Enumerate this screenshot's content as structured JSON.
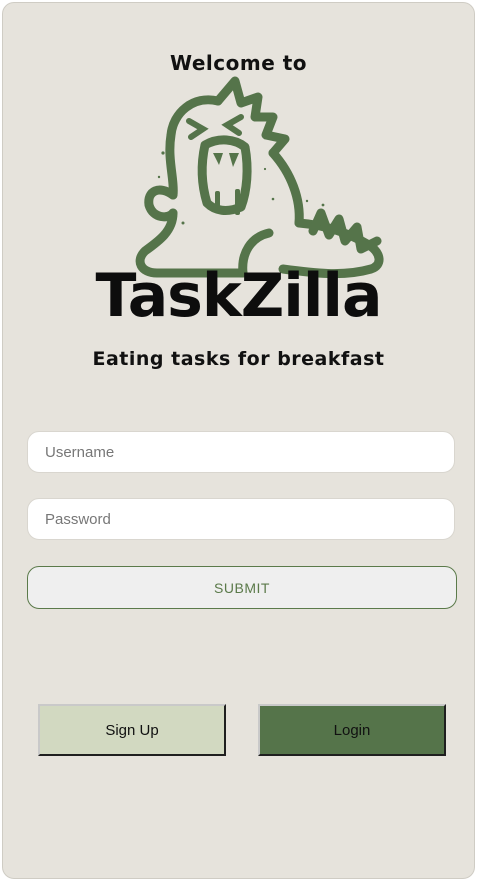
{
  "header": {
    "welcome": "Welcome to",
    "brand": "TaskZilla",
    "tagline": "Eating tasks for breakfast",
    "logo_icon": "dinosaur-icon"
  },
  "form": {
    "username": {
      "value": "",
      "placeholder": "Username"
    },
    "password": {
      "value": "",
      "placeholder": "Password"
    },
    "submit_label": "SUBMIT"
  },
  "actions": {
    "signup_label": "Sign Up",
    "login_label": "Login"
  },
  "colors": {
    "background": "#e6e3dc",
    "accent_green": "#55744a",
    "light_green": "#d2d9c1",
    "submit_text": "#5b7a4a"
  }
}
